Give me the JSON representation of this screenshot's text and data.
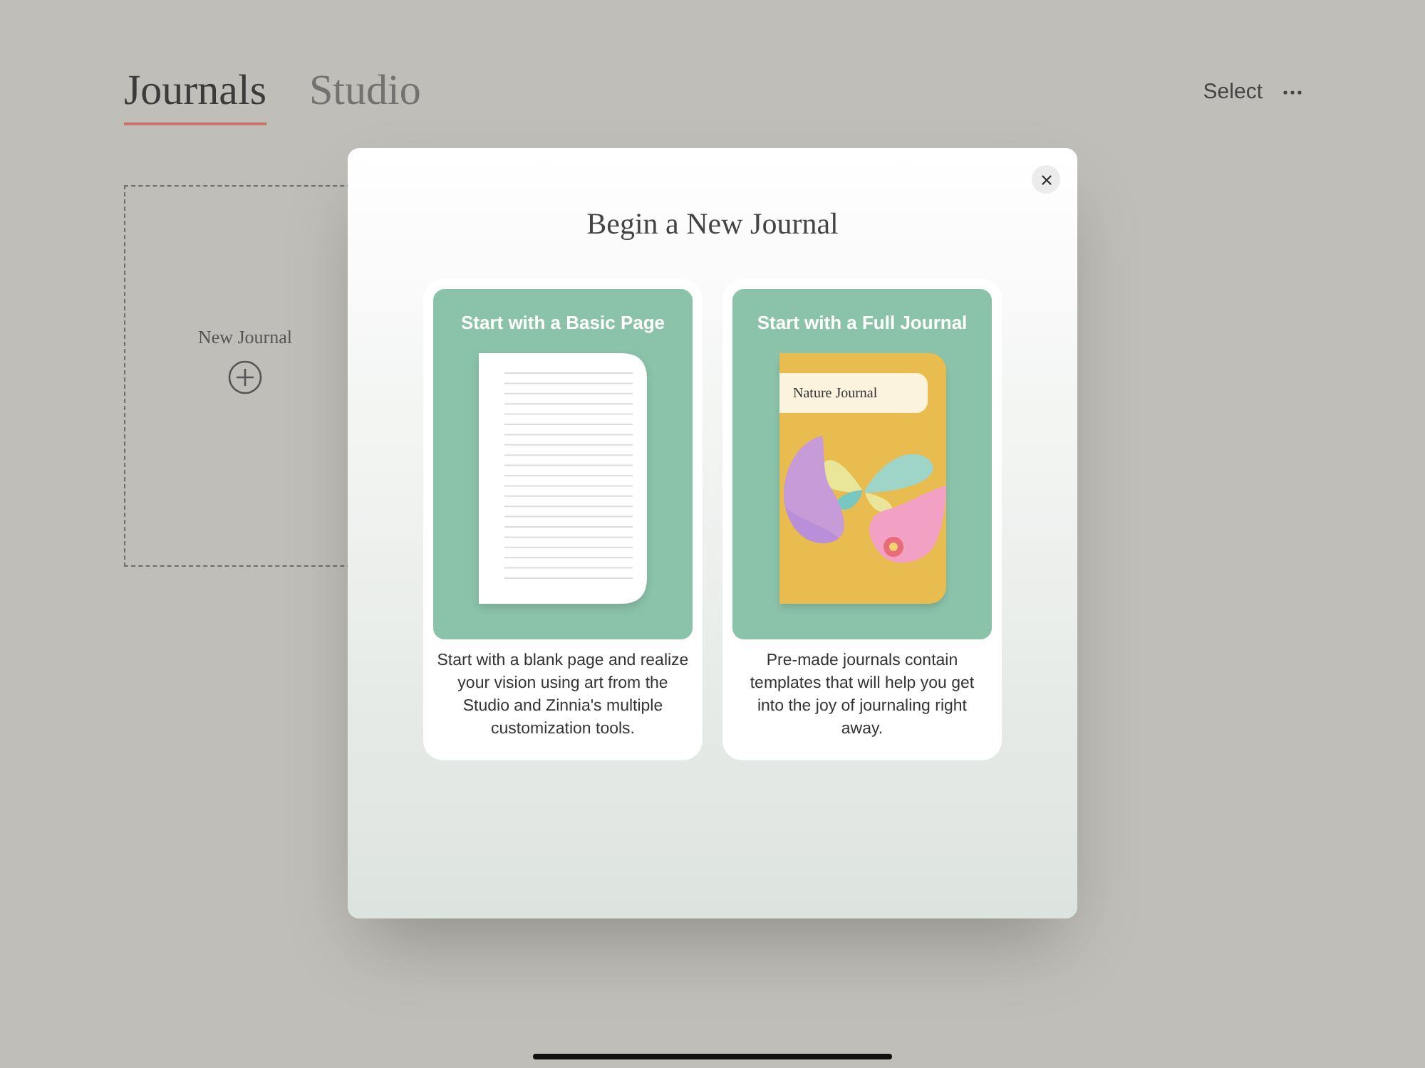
{
  "tabs": [
    {
      "label": "Journals",
      "selected": true
    },
    {
      "label": "Studio",
      "selected": false
    }
  ],
  "select_button": "Select",
  "new_journal": {
    "label": "New Journal"
  },
  "dialog": {
    "title": "Begin a New Journal",
    "options": [
      {
        "kind": "basic",
        "title": "Start with a Basic Page",
        "description": "Start with a blank page and realize your vision using art from the Studio and Zinnia's multiple customization tools."
      },
      {
        "kind": "full",
        "title": "Start with a Full Journal",
        "cover_title": "Nature Journal",
        "description": "Pre-made journals contain templates that will help you get into the joy of journaling right away."
      }
    ]
  }
}
